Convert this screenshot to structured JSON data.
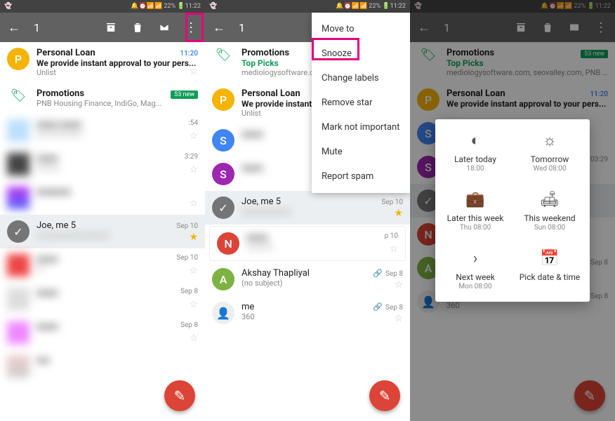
{
  "status": {
    "left_icon": "👻",
    "icons": "🔔⏰📶📶 22% 🔋11:22"
  },
  "toolbar": {
    "selected_count": "1",
    "icons": {
      "back": "←",
      "archive": "🗃",
      "delete": "🗑",
      "mail": "✉",
      "more": "⋮"
    }
  },
  "screen1_highlight": true,
  "emails": {
    "personal_loan": {
      "sender": "Personal Loan",
      "subject": "We provide instant approval to your pers...",
      "preview": "Unlist",
      "time": "11:20"
    },
    "promotions": {
      "label": "Promotions",
      "preview_s1": "PNB Housing Finance, IndiGo, Mag...",
      "preview_s2": "Top Picks",
      "preview_s2b": "mediologysoftware.com",
      "preview_s3": "Top Picks",
      "preview_s3b": "mediologysoftware.com, seovalley.com, PNB Housi...",
      "badge": "53 new"
    },
    "joe": {
      "sender": "Joe, me  5",
      "time": "Sep 10"
    },
    "akshay": {
      "sender": "Akshay Thapliyal",
      "subject": "(no subject)",
      "time": "Sep 8"
    },
    "me": {
      "sender": "me",
      "subject": "360",
      "time": "Sep 8"
    },
    "blur_times": {
      "a": ":54",
      "b": "3:29",
      "c": "03:29",
      "d": "Sep 10",
      "e": "Sep 8",
      "f": "p 10"
    }
  },
  "menu": {
    "items": [
      "Move to",
      "Snooze",
      "Change labels",
      "Remove star",
      "Mark not important",
      "Mute",
      "Report spam"
    ],
    "highlight_index": 1
  },
  "snooze": {
    "options": [
      {
        "icon": "◐",
        "label": "Later today",
        "sub": "18:00"
      },
      {
        "icon": "☼",
        "label": "Tomorrow",
        "sub": "Wed 08:00"
      },
      {
        "icon": "💼",
        "label": "Later this week",
        "sub": "Thu 08:00"
      },
      {
        "icon": "🛋",
        "label": "This weekend",
        "sub": "Sun 08:00"
      },
      {
        "icon": "›",
        "label": "Next week",
        "sub": "Mon 08:00"
      },
      {
        "icon": "📅",
        "label": "Pick date & time",
        "sub": ""
      }
    ]
  },
  "colors": {
    "av_p": "#f4b400",
    "av_s_blue": "#4285f4",
    "av_s_purple": "#9c27b0",
    "av_n": "#db4437",
    "av_a": "#7cb342"
  },
  "fab_icon": "✎"
}
